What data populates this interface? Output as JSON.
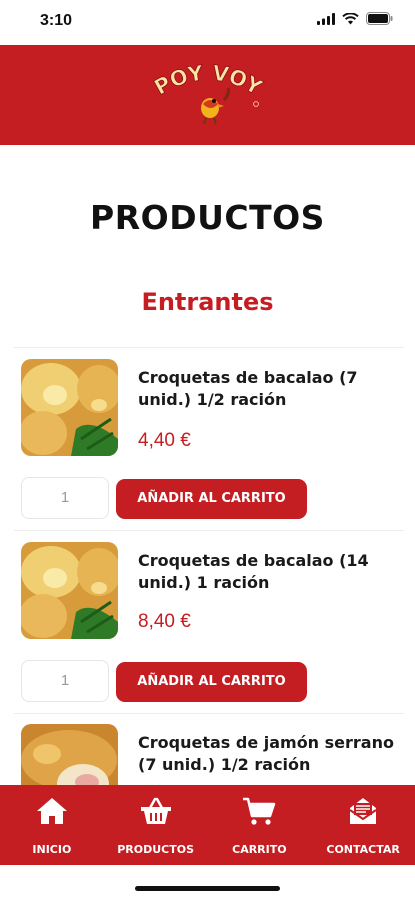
{
  "status_bar": {
    "time": "3:10"
  },
  "header": {
    "logo_text": "POY VOY"
  },
  "page": {
    "title": "PRODUCTOS",
    "section_title": "Entrantes"
  },
  "products": [
    {
      "name": "Croquetas de bacalao (7 unid.) 1/2 ración",
      "price": "4,40 €",
      "quantity": "1",
      "add_label": "AÑADIR AL CARRITO"
    },
    {
      "name": "Croquetas de bacalao (14 unid.) 1 ración",
      "price": "8,40 €",
      "quantity": "1",
      "add_label": "AÑADIR AL CARRITO"
    },
    {
      "name": "Croquetas de jamón serrano (7 unid.) 1/2 ración",
      "price": "",
      "quantity": "",
      "add_label": ""
    }
  ],
  "tabbar": {
    "items": [
      {
        "label": "INICIO",
        "icon": "home-icon"
      },
      {
        "label": "PRODUCTOS",
        "icon": "basket-icon"
      },
      {
        "label": "CARRITO",
        "icon": "cart-icon"
      },
      {
        "label": "CONTACTAR",
        "icon": "mail-icon"
      }
    ]
  },
  "colors": {
    "brand_red": "#c41d22",
    "background": "#ffffff",
    "text": "#1a1a1a"
  }
}
